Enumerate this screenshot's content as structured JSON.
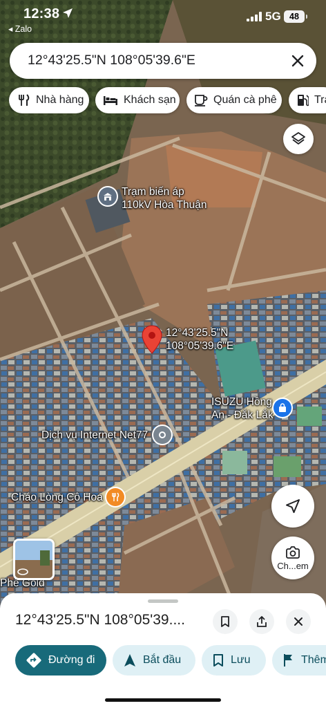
{
  "status_bar": {
    "time": "12:38",
    "back_app": "◂ Zalo",
    "network": "5G",
    "battery": "48"
  },
  "search": {
    "query": "12°43'25.5\"N 108°05'39.6\"E"
  },
  "chips": [
    {
      "label": "Nhà hàng",
      "icon": "fork-knife-icon"
    },
    {
      "label": "Khách sạn",
      "icon": "bed-icon"
    },
    {
      "label": "Quán cà phê",
      "icon": "coffee-cup-icon"
    },
    {
      "label": "Trạm",
      "icon": "gas-pump-icon"
    }
  ],
  "map": {
    "labels": {
      "substation_line1": "Trạm biến áp",
      "substation_line2": "110kV Hòa Thuận",
      "pin_line1": "12°43'25.5\"N",
      "pin_line2": "108°05'39.6\"E",
      "isuzu_line1": "ISUZU Hồng",
      "isuzu_line2": "An - Đắk Lắk",
      "internet": "Dịch vụ Internet Net77",
      "restaurant": "Cháo Lòng Cô Hoa",
      "cafe_partial": "Phê Gold"
    },
    "streetview_label": "Ch...em",
    "colors": {
      "pin": "#ea4335",
      "restaurant_poi": "#f28b24",
      "shop_poi": "#1a73e8"
    }
  },
  "place_sheet": {
    "title": "12°43'25.5\"N 108°05'39....",
    "actions": [
      {
        "label": "Đường đi",
        "icon": "directions-icon"
      },
      {
        "label": "Bắt đầu",
        "icon": "navigation-arrow-icon"
      },
      {
        "label": "Lưu",
        "icon": "bookmark-icon"
      },
      {
        "label": "Thêm",
        "icon": "flag-icon"
      }
    ],
    "accent": "#186a7a"
  }
}
